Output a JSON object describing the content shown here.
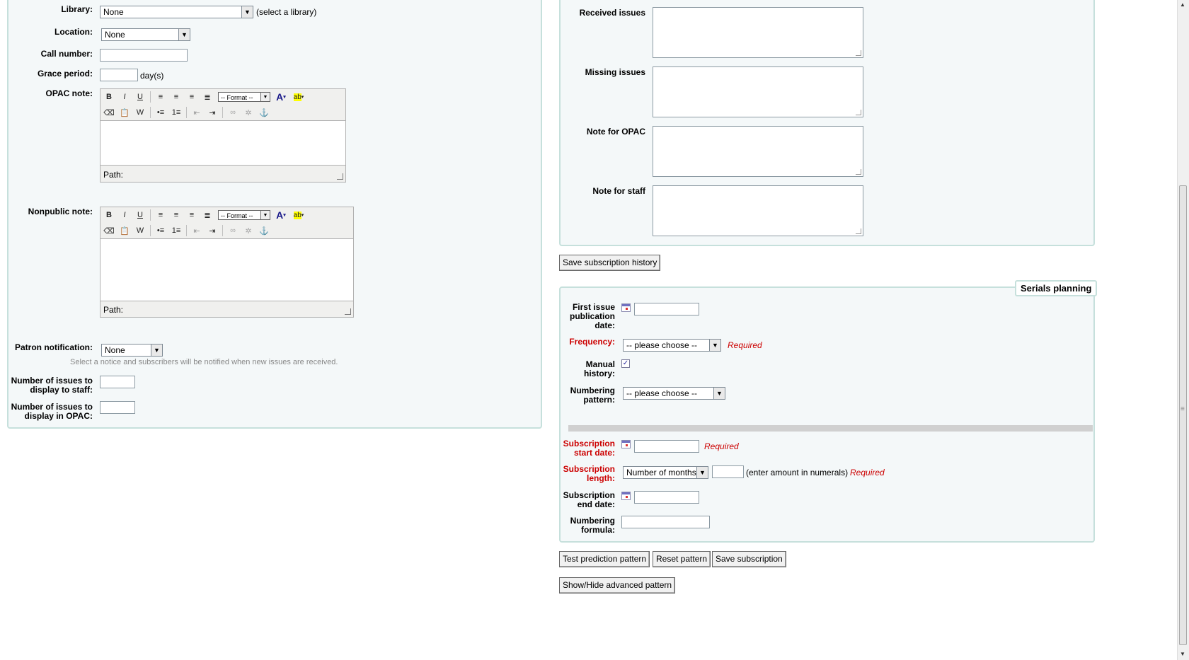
{
  "left": {
    "library": {
      "label": "Library:",
      "value": "None",
      "hint": "(select a library)"
    },
    "location": {
      "label": "Location:",
      "value": "None"
    },
    "call_number": {
      "label": "Call number:"
    },
    "grace_period": {
      "label": "Grace period:",
      "unit": "day(s)"
    },
    "opac_note": {
      "label": "OPAC note:",
      "path": "Path:"
    },
    "nonpublic_note": {
      "label": "Nonpublic note:",
      "path": "Path:"
    },
    "editor_format": "-- Format --",
    "patron_notification": {
      "label": "Patron notification:",
      "value": "None",
      "hint": "Select a notice and subscribers will be notified when new issues are received."
    },
    "issues_staff": {
      "label_1": "Number of issues to",
      "label_2": "display to staff:"
    },
    "issues_opac": {
      "label_1": "Number of issues to",
      "label_2": "display in OPAC:"
    }
  },
  "history": {
    "received": "Received issues",
    "missing": "Missing issues",
    "note_opac": "Note for OPAC",
    "note_staff": "Note for staff",
    "save_button": "Save subscription history"
  },
  "planning": {
    "legend": "Serials planning",
    "first_issue": {
      "l1": "First issue",
      "l2": "publication",
      "l3": "date:"
    },
    "frequency": {
      "label": "Frequency:",
      "value": "-- please choose --",
      "required": "Required"
    },
    "manual_history": {
      "l1": "Manual",
      "l2": "history:",
      "checked": true
    },
    "numbering_pattern": {
      "l1": "Numbering",
      "l2": "pattern:",
      "value": "-- please choose --"
    },
    "start_date": {
      "l1": "Subscription",
      "l2": "start date:",
      "required": "Required"
    },
    "length": {
      "l1": "Subscription",
      "l2": "length:",
      "unit_value": "Number of months",
      "hint": "(enter amount in numerals)",
      "required": "Required"
    },
    "end_date": {
      "l1": "Subscription",
      "l2": "end date:"
    },
    "numbering_formula": {
      "l1": "Numbering",
      "l2": "formula:"
    }
  },
  "buttons": {
    "test_prediction": "Test prediction pattern",
    "reset_pattern": "Reset pattern",
    "save_subscription": "Save subscription",
    "show_hide_advanced": "Show/Hide advanced pattern"
  },
  "icons": {
    "bold": "B",
    "italic": "I",
    "underline": "U",
    "text_color": "A",
    "highlight": "ab",
    "anchor": "⚓"
  }
}
